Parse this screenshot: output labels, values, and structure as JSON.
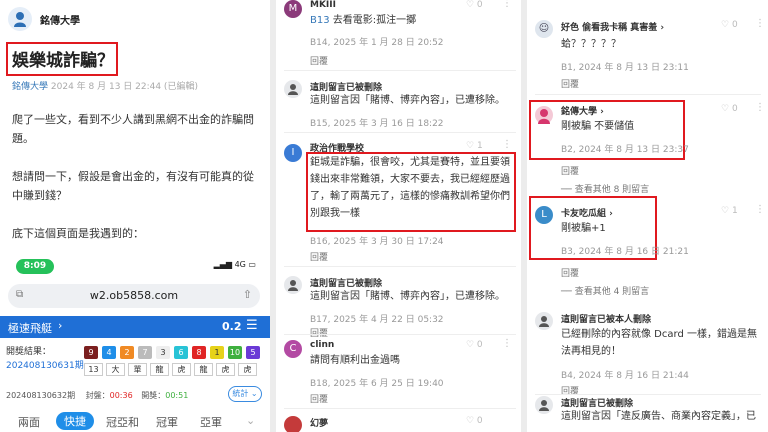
{
  "panel1": {
    "author_school": "銘傳大學",
    "title": "娛樂城詐騙？",
    "meta_school": "銘傳大學",
    "meta_date": "2024 年 8 月 13 日 22:44 (已編輯)",
    "body": [
      "爬了一些文，看到不少人講到黑網不出金的詐騙問題。",
      "想請問一下，假設是會出金的，有沒有可能真的從中賺到錢？",
      "底下這個頁面是我遇到的："
    ],
    "embedded": {
      "time": "8:09",
      "network": "4G",
      "url": "w2.ob5858.com",
      "game_title": "極速飛艇",
      "game_value": "0.2",
      "result_label": "開獎結果：",
      "draw_id": "20240813063​1期",
      "numbers": [
        "9",
        "4",
        "2",
        "7",
        "3",
        "6",
        "8",
        "1",
        "10",
        "5"
      ],
      "cells": [
        "13",
        "大",
        "單",
        "龍",
        "虎",
        "龍",
        "虎",
        "虎"
      ],
      "period": "20240813063​2期",
      "seal_label": "封盤：",
      "seal_time": "00:36",
      "open_label": "開獎：",
      "open_time": "00:51",
      "stat_label": "統計",
      "tabs": [
        "兩面",
        "快捷",
        "冠亞和",
        "冠軍",
        "亞軍"
      ]
    }
  },
  "panel2": {
    "comments": [
      {
        "name": "MKIII",
        "ref": "B13",
        "text": "去看電影:孤注一擲",
        "meta": "B14, 2025 年 1 月 28 日 20:52",
        "reply": "回覆"
      },
      {
        "name": "這則留言已被刪除",
        "text": "這則留言因「賭博、博弈內容」，已遭移除。",
        "meta": "B15, 2025 年 3 月 16 日 18:22",
        "reply": "回覆"
      },
      {
        "name": "政治作戰學校",
        "text": "鉅城是詐騙，很會咬，尤其是賽特，並且要領錢出來非常難領，大家不要去，我已經經歷過了，輸了兩萬元了，這樣的慘痛教訓希望你們別跟我一樣",
        "like": "1",
        "meta": "B16, 2025 年 3 月 30 日 17:24",
        "reply": "回覆"
      },
      {
        "name": "這則留言已被刪除",
        "text": "這則留言因「賭博、博弈內容」，已遭移除。",
        "meta": "B17, 2025 年 4 月 22 日 05:32",
        "reply": "回覆"
      },
      {
        "name": "clinn",
        "text": "請問有順利出金過嗎",
        "meta": "B18, 2025 年 6 月 25 日 19:40",
        "reply": "回覆"
      },
      {
        "name": "幻夢"
      }
    ]
  },
  "panel3": {
    "comments": [
      {
        "name": "好色 偷看我卡稱 真害羞",
        "text": "蛤？？？？？",
        "like": "0",
        "meta": "B1, 2024 年 8 月 13 日 23:11",
        "reply": "回覆"
      },
      {
        "name": "銘傳大學",
        "text": "剛被騙 不要儲值",
        "like": "0",
        "meta": "B2, 2024 年 8 月 13 日 23:37",
        "reply": "回覆",
        "more": "查看其他 8 則留言"
      },
      {
        "name": "卡友吃瓜組",
        "text": "剛被騙+1",
        "like": "1",
        "meta": "B3, 2024 年 8 月 16 日 21:21",
        "reply": "回覆",
        "more": "查看其他 4 則留言"
      },
      {
        "name": "這則留言已被本人刪除",
        "text": "已經刪除的內容就像 Dcard 一樣，錯過是無法再相見的！",
        "meta": "B4, 2024 年 8 月 16 日 21:44",
        "reply": "回覆"
      },
      {
        "name": "這則留言已被刪除",
        "text": "這則留言因「違反廣告、商業內容定義」，已"
      }
    ]
  },
  "colors": {
    "red_box": "#e0191f",
    "link": "#3678b8",
    "game_blue": "#1f6fd6"
  }
}
